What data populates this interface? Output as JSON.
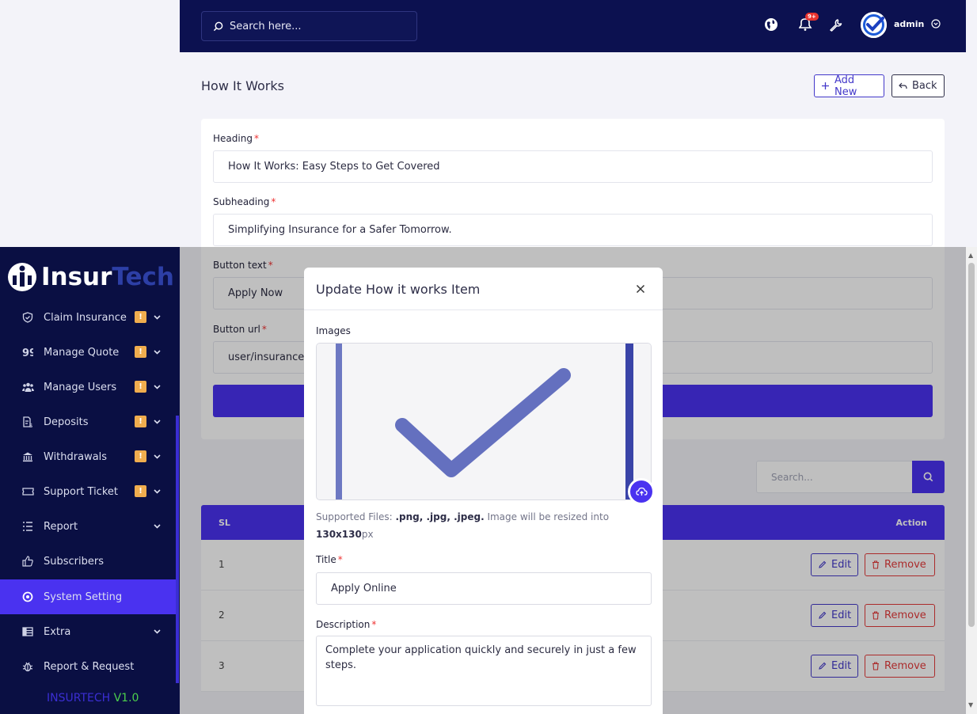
{
  "topbar": {
    "search_placeholder": "Search here...",
    "notification_badge": "9+",
    "user_name": "admin"
  },
  "page": {
    "title": "How It Works",
    "add_new_label": "Add New",
    "back_label": "Back"
  },
  "form": {
    "heading_label": "Heading",
    "heading_value": "How It Works: Easy Steps to Get Covered",
    "subheading_label": "Subheading",
    "subheading_value": "Simplifying Insurance for a Safer Tomorrow.",
    "button_text_label": "Button text",
    "button_text_value": "Apply Now",
    "button_url_label": "Button url",
    "button_url_value": "user/insurance"
  },
  "table": {
    "search_placeholder": "Search...",
    "col_sl": "SL",
    "col_action": "Action",
    "edit_label": "Edit",
    "remove_label": "Remove",
    "rows": [
      {
        "sl": "1"
      },
      {
        "sl": "2"
      },
      {
        "sl": "3"
      }
    ]
  },
  "sidebar": {
    "logo_part1": "Insur",
    "logo_part2": "Tech",
    "badge": "!",
    "items": [
      {
        "label": "Claim Insurance",
        "icon": "shield-check-icon"
      },
      {
        "label": "Manage Quote",
        "icon": "quote-icon"
      },
      {
        "label": "Manage Users",
        "icon": "users-icon"
      },
      {
        "label": "Deposits",
        "icon": "deposit-icon"
      },
      {
        "label": "Withdrawals",
        "icon": "bank-icon"
      },
      {
        "label": "Support Ticket",
        "icon": "ticket-icon"
      },
      {
        "label": "Report",
        "icon": "list-icon"
      },
      {
        "label": "Subscribers",
        "icon": "thumbs-up-icon"
      },
      {
        "label": "System Setting",
        "icon": "settings-icon"
      },
      {
        "label": "Extra",
        "icon": "grid-icon"
      },
      {
        "label": "Report & Request",
        "icon": "bug-icon"
      }
    ],
    "version_brand": "INSURTECH",
    "version_number": "V1.0"
  },
  "modal": {
    "title": "Update How it works Item",
    "images_label": "Images",
    "supported_prefix": "Supported Files:",
    "supported_types": ".png, .jpg, .jpeg.",
    "resize_text": "Image will be resized into",
    "resize_size": "130x130",
    "resize_unit": "px",
    "title_label": "Title",
    "title_value": "Apply Online",
    "description_label": "Description",
    "description_value": "Complete your application quickly and securely in just a few steps."
  },
  "colors": {
    "primary": "#4a32f0",
    "navy": "#0a0f43",
    "danger": "#e43a3a",
    "badge": "#f0ad4e"
  }
}
